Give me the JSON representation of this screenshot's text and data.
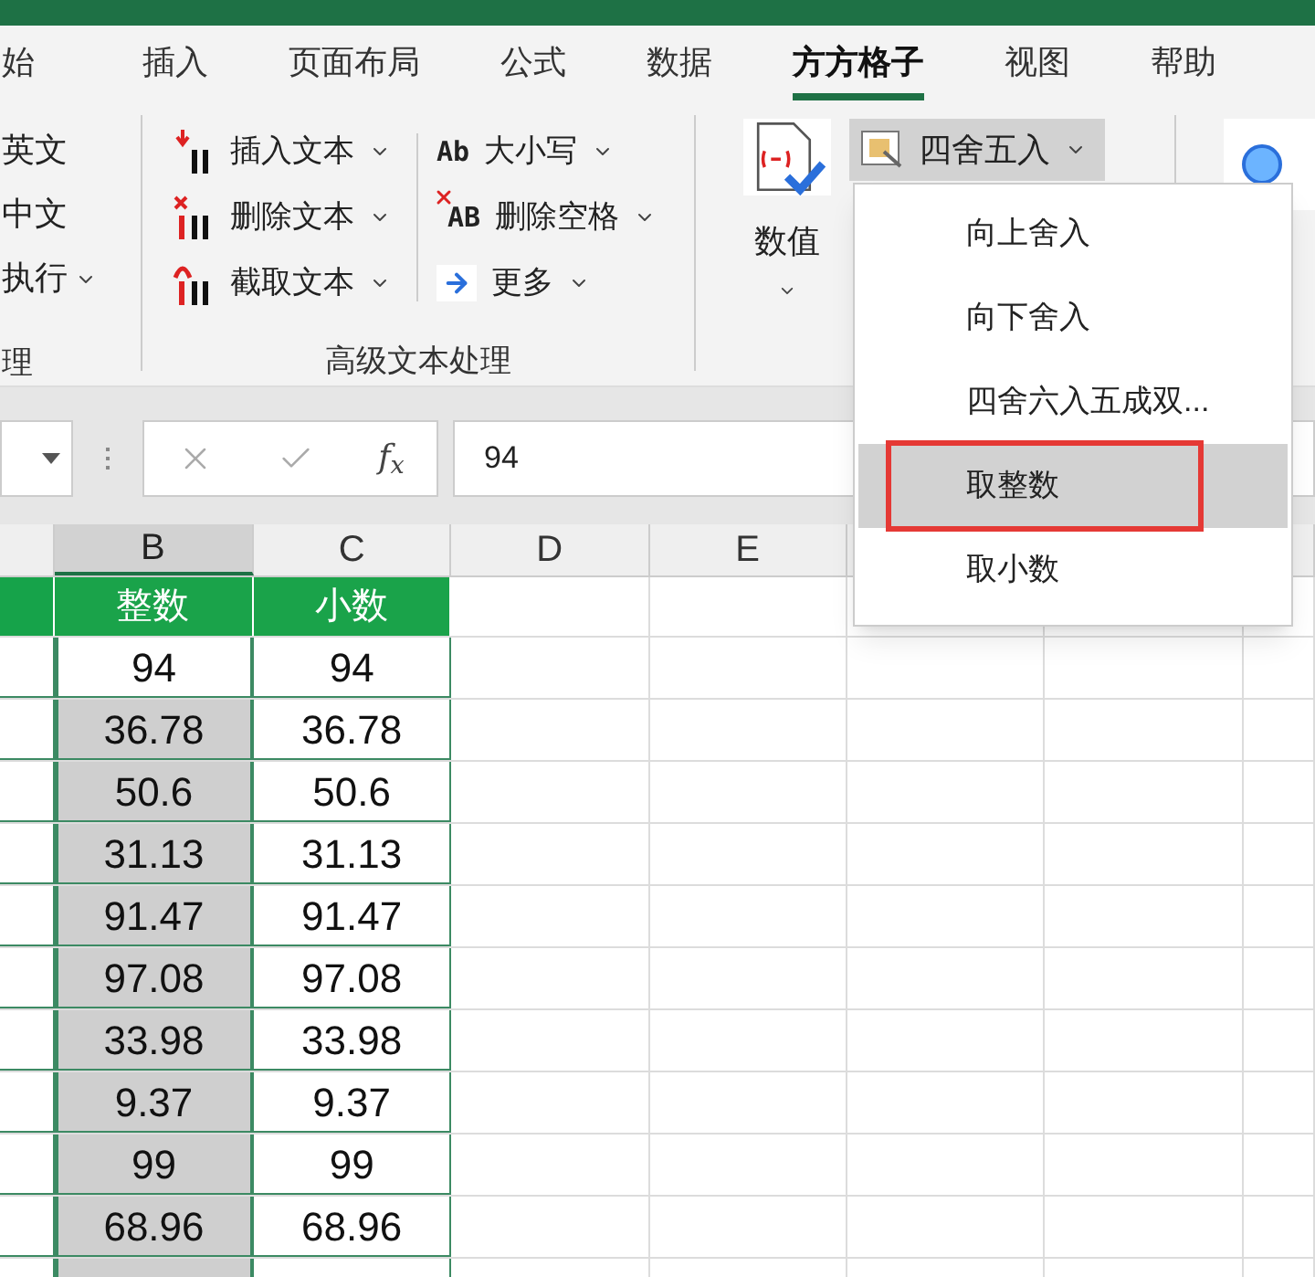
{
  "tabs": [
    {
      "label": "始",
      "selected": false
    },
    {
      "label": "插入",
      "selected": false
    },
    {
      "label": "页面布局",
      "selected": false
    },
    {
      "label": "公式",
      "selected": false
    },
    {
      "label": "数据",
      "selected": false
    },
    {
      "label": "方方格子",
      "selected": true
    },
    {
      "label": "视图",
      "selected": false
    },
    {
      "label": "帮助",
      "selected": false
    }
  ],
  "ribbon": {
    "left_group": {
      "label": "理",
      "items": [
        {
          "label": "英文",
          "dropdown": false
        },
        {
          "label": "中文",
          "dropdown": false
        },
        {
          "label": "执行",
          "dropdown": true
        }
      ]
    },
    "text_group": {
      "label": "高级文本处理",
      "columns": [
        [
          {
            "label": "插入文本",
            "dropdown": true
          },
          {
            "label": "删除文本",
            "dropdown": true
          },
          {
            "label": "截取文本",
            "dropdown": true
          }
        ],
        [
          {
            "label": "大小写",
            "icon_text": "Ab",
            "dropdown": true
          },
          {
            "label": "删除空格",
            "icon_text": "AB",
            "dropdown": true
          },
          {
            "label": "更多",
            "dropdown": true
          }
        ]
      ]
    },
    "number_button": {
      "label": "数值",
      "dropdown": true
    },
    "round_button": {
      "label": "四舍五入",
      "dropdown": true,
      "selected": true
    }
  },
  "menu": {
    "items": [
      {
        "label": "向上舍入",
        "selected": false,
        "outlined": false
      },
      {
        "label": "向下舍入",
        "selected": false,
        "outlined": false
      },
      {
        "label": "四舍六入五成双...",
        "selected": false,
        "outlined": false
      },
      {
        "label": "取整数",
        "selected": true,
        "outlined": true
      },
      {
        "label": "取小数",
        "selected": false,
        "outlined": false
      }
    ]
  },
  "formula_bar": {
    "function_label": "f$_{x}$",
    "value": "94"
  },
  "columns": [
    {
      "label": "B",
      "selected": true
    },
    {
      "label": "C",
      "selected": false
    },
    {
      "label": "D",
      "selected": false
    },
    {
      "label": "E",
      "selected": false
    }
  ],
  "header_row": [
    "整数",
    "小数"
  ],
  "rows": [
    {
      "b": "94",
      "c": "94",
      "selected": false
    },
    {
      "b": "36.78",
      "c": "36.78",
      "selected": true
    },
    {
      "b": "50.6",
      "c": "50.6",
      "selected": true
    },
    {
      "b": "31.13",
      "c": "31.13",
      "selected": true
    },
    {
      "b": "91.47",
      "c": "91.47",
      "selected": true
    },
    {
      "b": "97.08",
      "c": "97.08",
      "selected": true
    },
    {
      "b": "33.98",
      "c": "33.98",
      "selected": true
    },
    {
      "b": "9.37",
      "c": "9.37",
      "selected": true
    },
    {
      "b": "99",
      "c": "99",
      "selected": true
    },
    {
      "b": "68.96",
      "c": "68.96",
      "selected": true
    }
  ]
}
